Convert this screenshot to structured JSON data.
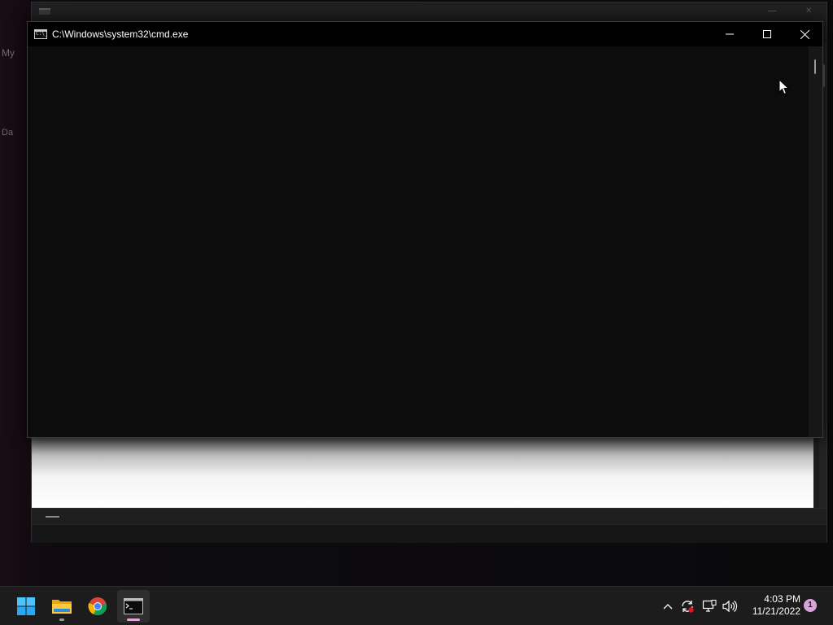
{
  "desktop": {
    "edge_text_1": "My",
    "edge_text_2": "Da"
  },
  "cmd_window": {
    "title": "C:\\Windows\\system32\\cmd.exe",
    "icon": "cmd-console-icon",
    "icon_glyph": "C:\\_",
    "minimize_icon": "minimize-icon",
    "maximize_icon": "maximize-icon",
    "close_icon": "close-icon",
    "background_color": "#0c0c0c",
    "content": ""
  },
  "background_window": {
    "close_glyph": "✕"
  },
  "taskbar": {
    "items": [
      {
        "name": "Start",
        "icon": "windows-start-icon",
        "active": false
      },
      {
        "name": "File Explorer",
        "icon": "folder-icon",
        "active": false,
        "running": true
      },
      {
        "name": "Google Chrome",
        "icon": "chrome-icon",
        "active": false
      },
      {
        "name": "Command Prompt",
        "icon": "cmd-console-icon",
        "active": true,
        "running": true
      }
    ],
    "tray": {
      "icons": [
        "chevron-up-icon",
        "sync-icon",
        "network-icon",
        "volume-icon"
      ],
      "time": "4:03 PM",
      "date": "11/21/2022",
      "notification_count": "1"
    },
    "accent_color": "#e6a6d6"
  }
}
